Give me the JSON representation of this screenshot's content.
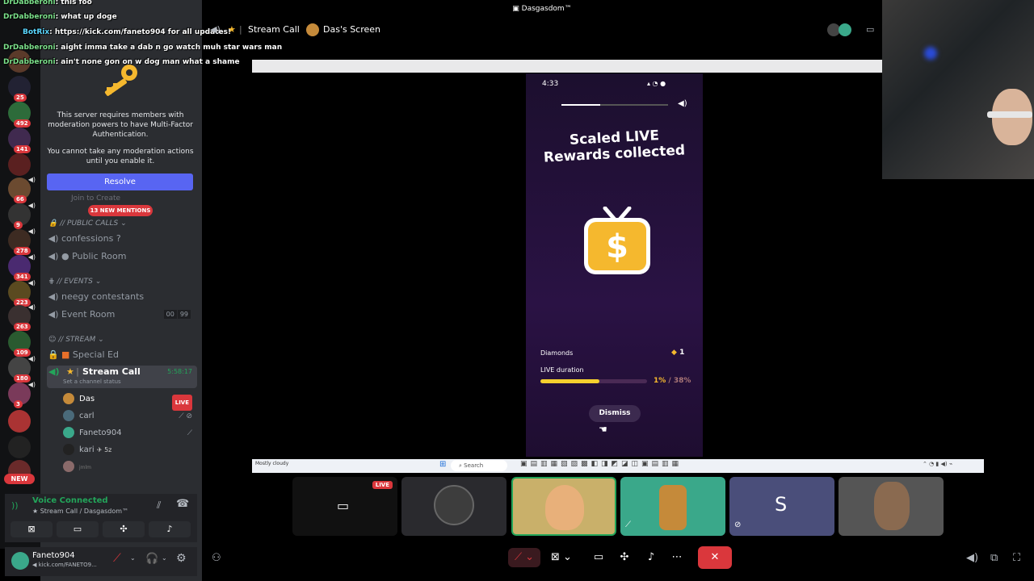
{
  "window_title": "Dasgasdom™",
  "chat": [
    {
      "nick": "DrDabberoni",
      "text": ": this foo"
    },
    {
      "nick": "DrDabberoni",
      "text": ": what up doge"
    },
    {
      "nick": "BotRix",
      "text": ": https://kick.com/faneto904 for all updates!"
    },
    {
      "nick": "DrDabberoni",
      "text": ": aight imma take a dab n go watch muh star wars man"
    },
    {
      "nick": "DrDabberoni",
      "text": ": ain't none gon on w dog man what a shame"
    }
  ],
  "server_badges": [
    "25",
    "492",
    "141",
    "66",
    "9",
    "278",
    "341",
    "223",
    "263",
    "109",
    "180",
    "3"
  ],
  "new_pill": "NEW",
  "mfa": {
    "text1": "This server requires members with moderation powers to have Multi-Factor Authentication.",
    "text2": "You cannot take any moderation actions until you enable it.",
    "resolve": "Resolve"
  },
  "mentions": "13 NEW MENTIONS",
  "join_to_create": "Join to Create",
  "categories": {
    "public_calls": "// PUBLIC CALLS",
    "events": "// Events",
    "stream": "// STREAM"
  },
  "channels": {
    "confessions": "confessions ?",
    "public_room": "Public Room",
    "neegy": "neegy contestants",
    "event_room": "Event Room",
    "event_room_counts": [
      "00",
      "99"
    ],
    "special_ed": "Special Ed",
    "stream_call": "Stream Call",
    "stream_call_timer": "5:58:17",
    "stream_call_status": "Set a channel status"
  },
  "voice_users": [
    {
      "name": "Das",
      "live": "LIVE"
    },
    {
      "name": "carl"
    },
    {
      "name": "Faneto904"
    },
    {
      "name": "kari",
      "extra": "5z"
    },
    {
      "name": "jmlm"
    }
  ],
  "voice_panel": {
    "status": "Voice Connected",
    "location": "Stream Call / Dasgasdom™"
  },
  "user_panel": {
    "name": "Faneto904",
    "status": "kick.com/FANETO9..."
  },
  "header": {
    "channel": "Stream Call",
    "screen": "Das's Screen"
  },
  "phone": {
    "time": "4:33",
    "title1": "Scaled LIVE",
    "title2": "Rewards collected",
    "diamonds_label": "Diamonds",
    "diamonds_value": "1",
    "duration_label": "LIVE duration",
    "duration_pct": "1%",
    "duration_total": "/ 38%",
    "duration_fill": 0.55,
    "dismiss": "Dismiss"
  },
  "taskbar": {
    "weather": "Mostly cloudy",
    "search": "Search"
  },
  "tiles": {
    "live": "LIVE",
    "s_letter": "S"
  },
  "colors": {
    "accent": "#5865f2",
    "danger": "#da373c",
    "green": "#23a55a",
    "gold": "#f5b82e"
  }
}
